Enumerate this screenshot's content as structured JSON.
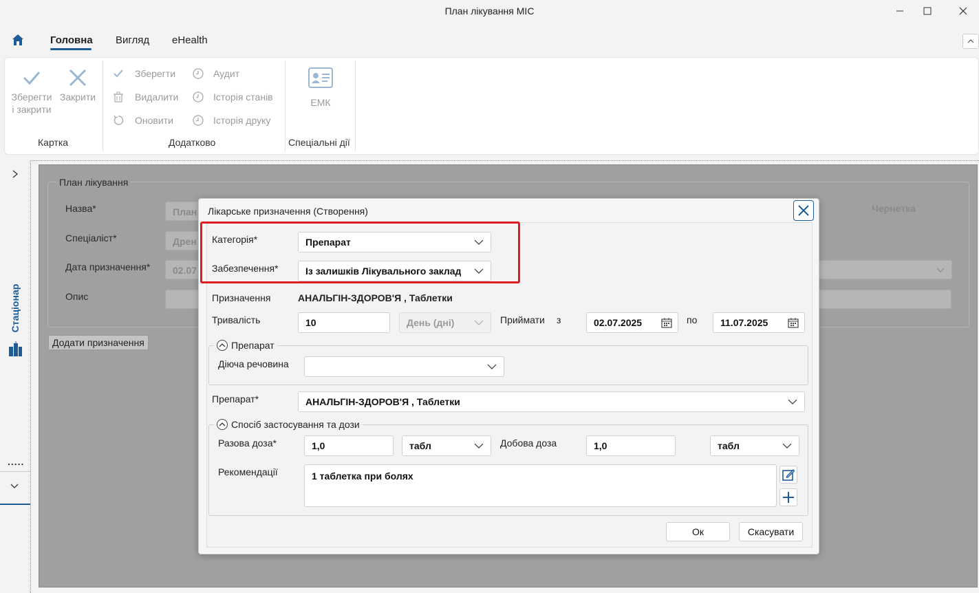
{
  "window": {
    "title": "План лікування МІС"
  },
  "menu": {
    "home_icon": "home-icon",
    "items": [
      "Головна",
      "Вигляд",
      "eHealth"
    ]
  },
  "ribbon": {
    "save_close": "Зберегти і закрити",
    "save_close_line1": "Зберегти",
    "save_close_line2": "і закрити",
    "close": "Закрити",
    "group_card": "Картка",
    "save": "Зберегти",
    "delete": "Видалити",
    "refresh": "Оновити",
    "audit": "Аудит",
    "status_history": "Історія станів",
    "print_history": "Історія друку",
    "group_extra": "Додатково",
    "emk": "ЕМК",
    "group_special": "Спеціальні дії"
  },
  "left_strip": {
    "label": "Стаціонар",
    "dots": "....."
  },
  "background_form": {
    "fieldset_title": "План лікування",
    "name_label": "Назва*",
    "name_value": "План",
    "specialist_label": "Спеціаліст*",
    "specialist_value": "Дрен",
    "date_label": "Дата призначення*",
    "date_value": "02.07",
    "description_label": "Опис",
    "status": "Чернетка",
    "add_button": "Додати призначення"
  },
  "dialog": {
    "title": "Лікарське призначення (Створення)",
    "category_label": "Категорія*",
    "category_value": "Препарат",
    "provision_label": "Забезпечення*",
    "provision_value": "Із залишків Лікувального заклад",
    "assignment_label": "Призначення",
    "assignment_value": "АНАЛЬГІН-ЗДОРОВ'Я , Таблетки",
    "duration_label": "Тривалість",
    "duration_value": "10",
    "duration_unit": "День (дні)",
    "take_label": "Приймати",
    "from_label": "з",
    "from_date": "02.07.2025",
    "to_label": "по",
    "to_date": "11.07.2025",
    "drug_section": "Препарат",
    "active_substance_label": "Діюча речовина",
    "active_substance_value": "",
    "drug_label": "Препарат*",
    "drug_value": "АНАЛЬГІН-ЗДОРОВ'Я , Таблетки",
    "dose_section": "Спосіб застосування та дози",
    "single_dose_label": "Разова доза*",
    "single_dose_value": "1,0",
    "single_dose_unit": "табл",
    "daily_dose_label": "Добова доза",
    "daily_dose_value": "1,0",
    "daily_dose_unit": "табл",
    "recommendations_label": "Рекомендації",
    "recommendations_value": "1 таблетка при болях",
    "ok": "Ок",
    "cancel": "Скасувати"
  },
  "colors": {
    "accent": "#1d5c96",
    "highlight": "#e11b22"
  }
}
